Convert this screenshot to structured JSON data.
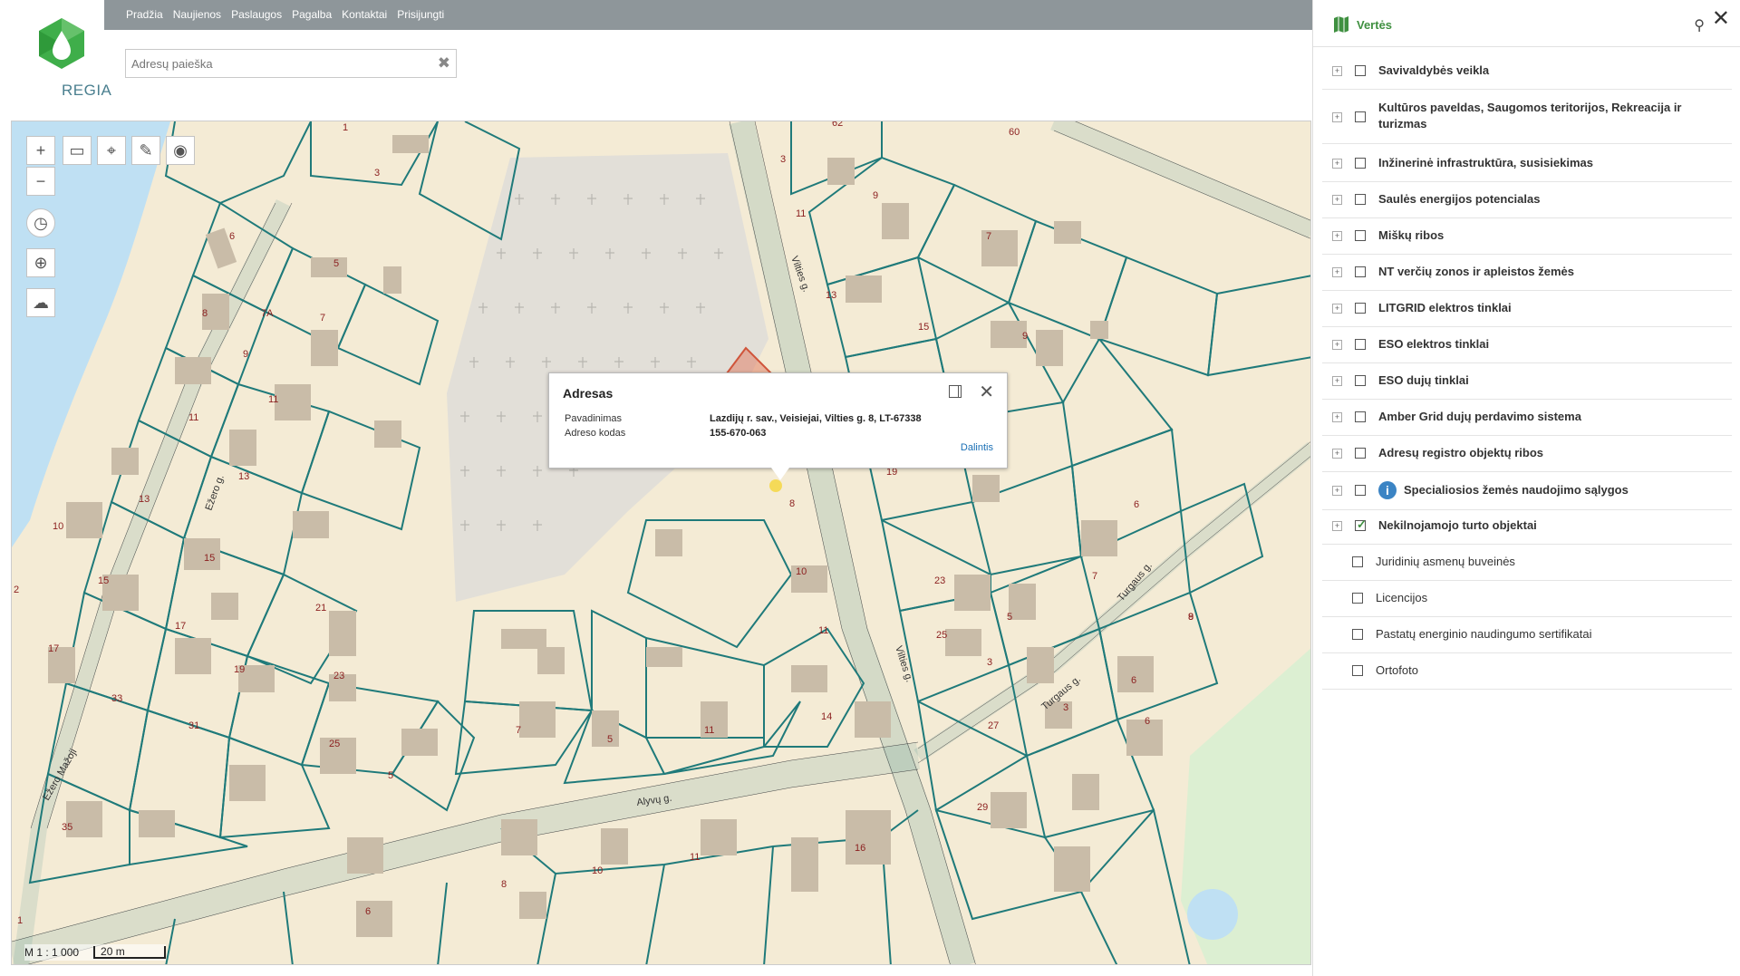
{
  "nav": {
    "links": [
      "Pradžia",
      "Naujienos",
      "Paslaugos",
      "Pagalba",
      "Kontaktai",
      "Prisijungti"
    ]
  },
  "logo": {
    "text": "REGIA",
    "icon": "regia-logo-icon"
  },
  "search": {
    "placeholder": "Adresų paieška",
    "value": ""
  },
  "map": {
    "labels": [
      "1",
      "3",
      "6",
      "5",
      "7",
      "7A",
      "8",
      "9",
      "11",
      "10",
      "11",
      "13",
      "13",
      "15",
      "15",
      "17",
      "17",
      "19",
      "21",
      "23",
      "25",
      "2",
      "33",
      "31",
      "5",
      "35",
      "1",
      "62",
      "60",
      "3",
      "11",
      "9",
      "7",
      "13",
      "15",
      "9",
      "19",
      "8",
      "10",
      "11",
      "14",
      "11",
      "7",
      "5",
      "23",
      "25",
      "5",
      "27",
      "7",
      "6",
      "3",
      "6",
      "29",
      "9",
      "8",
      "10",
      "11",
      "16",
      "8",
      "6"
    ],
    "streets": [
      "Vilties g.",
      "Alyvų g.",
      "Turgaus g.",
      "Turgaus g.",
      "Vilties g.",
      "Ežero g.",
      "Ežero Mažoji"
    ],
    "scale": {
      "ratio": "M 1 : 1 000",
      "bar": "20 m"
    },
    "tools": [
      "zoom-in-icon",
      "zoom-out-icon",
      "measure-icon",
      "marker-icon",
      "edit-icon",
      "target-icon",
      "compass-icon",
      "locate-icon",
      "chat-icon"
    ]
  },
  "popup": {
    "title": "Adresas",
    "rows": [
      {
        "label": "Pavadinimas",
        "value": "Lazdijų r. sav., Veisiejai, Vilties g. 8, LT-67338"
      },
      {
        "label": "Adreso kodas",
        "value": "155-670-063"
      }
    ],
    "share_label": "Dalintis"
  },
  "panel": {
    "title": "Vertės",
    "layers": [
      {
        "name": "Savivaldybės veikla",
        "checked": false,
        "expandable": true
      },
      {
        "name": "Kultūros paveldas, Saugomos teritorijos, Rekreacija ir turizmas",
        "checked": false,
        "expandable": true
      },
      {
        "name": "Inžinerinė infrastruktūra, susisiekimas",
        "checked": false,
        "expandable": true
      },
      {
        "name": "Saulės energijos potencialas",
        "checked": false,
        "expandable": true
      },
      {
        "name": "Miškų ribos",
        "checked": false,
        "expandable": true
      },
      {
        "name": "NT verčių zonos ir apleistos žemės",
        "checked": false,
        "expandable": true
      },
      {
        "name": "LITGRID elektros tinklai",
        "checked": false,
        "expandable": true
      },
      {
        "name": "ESO elektros tinklai",
        "checked": false,
        "expandable": true
      },
      {
        "name": "ESO dujų tinklai",
        "checked": false,
        "expandable": true
      },
      {
        "name": "Amber Grid dujų perdavimo sistema",
        "checked": false,
        "expandable": true
      },
      {
        "name": "Adresų registro objektų ribos",
        "checked": false,
        "expandable": true
      },
      {
        "name": "Specialiosios žemės naudojimo sąlygos",
        "checked": false,
        "expandable": true,
        "info": true
      },
      {
        "name": "Nekilnojamojo turto objektai",
        "checked": true,
        "expandable": true
      },
      {
        "name": "Juridinių asmenų buveinės",
        "checked": false,
        "expandable": false
      },
      {
        "name": "Licencijos",
        "checked": false,
        "expandable": false
      },
      {
        "name": "Pastatų energinio naudingumo sertifikatai",
        "checked": false,
        "expandable": false
      },
      {
        "name": "Ortofoto",
        "checked": false,
        "expandable": false
      }
    ]
  },
  "colors": {
    "accent": "#3f9040",
    "parcel": "#1f7a7a",
    "land": "#f4ebd5",
    "building": "#c9bca8",
    "water": "#bfe0f3"
  }
}
